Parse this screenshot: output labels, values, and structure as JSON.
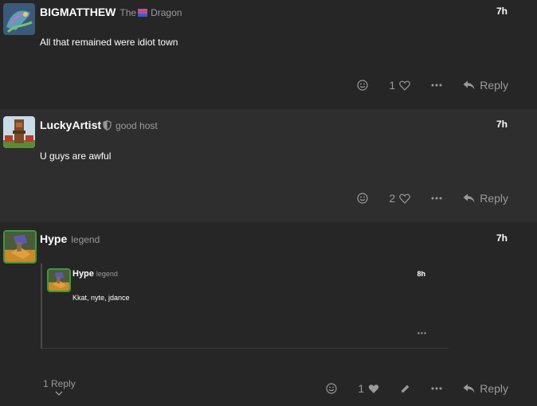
{
  "posts": [
    {
      "username": "BIGMATTHEW",
      "title_prefix": "The",
      "title_suffix": "Dragon",
      "time": "7h",
      "content": "All that remained were idiot town",
      "like_count": "1",
      "reply_label": "Reply"
    },
    {
      "username": "LuckyArtist",
      "title": "good host",
      "time": "7h",
      "content": "U guys are awful",
      "like_count": "2",
      "reply_label": "Reply"
    },
    {
      "username": "Hype",
      "title": "legend",
      "time": "7h",
      "like_count": "1",
      "reply_label": "Reply",
      "replies_toggle": "1 Reply",
      "nested_reply": {
        "username": "Hype",
        "title": "legend",
        "time": "8h",
        "content": "Kkat, nyte, jdance"
      }
    }
  ],
  "icons": {
    "emoji": "smile-icon",
    "like": "heart-icon",
    "more": "ellipsis-icon",
    "reply": "reply-arrow-icon",
    "edit": "pencil-icon",
    "chevron": "chevron-down-icon",
    "shield": "shield-icon",
    "flag": "flag-icon"
  },
  "colors": {
    "background": "#262626",
    "alt_background": "#2e2e2e",
    "text": "#ffffff",
    "muted": "#9a9a9a",
    "avatar_border": "#3a9a3a"
  }
}
